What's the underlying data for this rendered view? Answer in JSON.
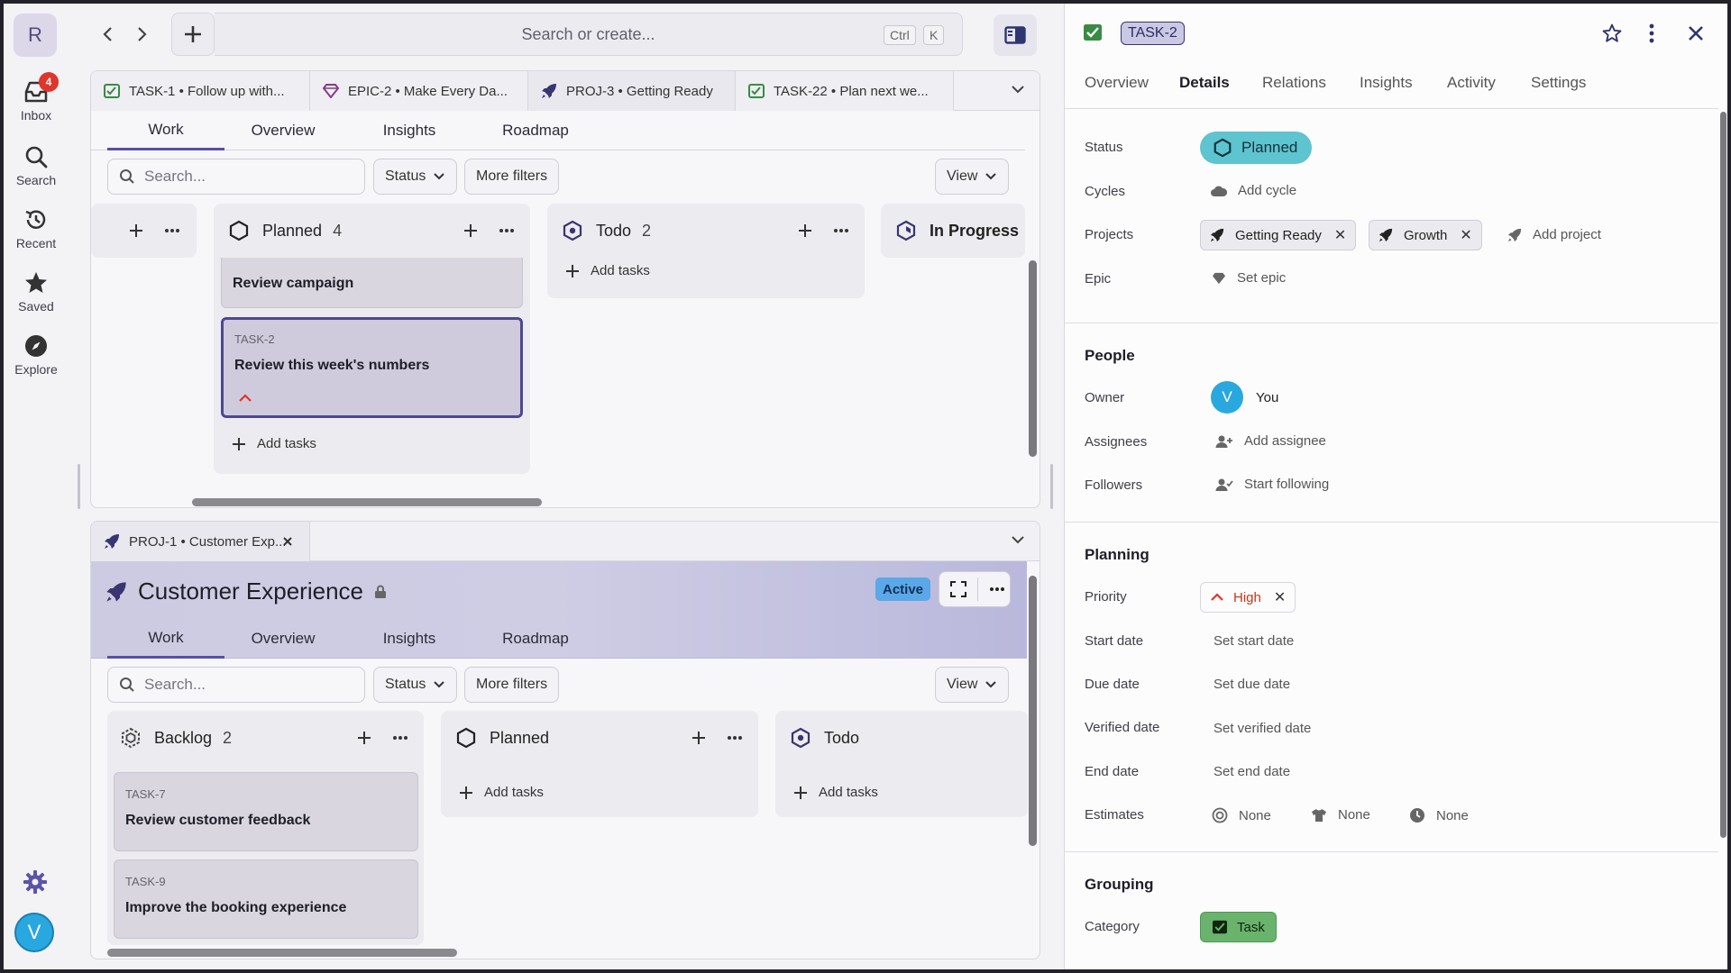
{
  "rail": {
    "workspace_initial": "R",
    "inbox_label": "Inbox",
    "inbox_badge": "4",
    "search_label": "Search",
    "recent_label": "Recent",
    "saved_label": "Saved",
    "explore_label": "Explore",
    "user_initial": "V"
  },
  "topbar": {
    "search_placeholder": "Search or create...",
    "kbd_ctrl": "Ctrl",
    "kbd_k": "K"
  },
  "top_pane": {
    "tabs": [
      {
        "label": "TASK-1 • Follow up with...",
        "icon": "task-icon"
      },
      {
        "label": "EPIC-2 • Make Every Da...",
        "icon": "epic-icon"
      },
      {
        "label": "PROJ-3 • Getting Ready",
        "icon": "rocket-icon"
      },
      {
        "label": "TASK-22 • Plan next we...",
        "icon": "task-icon"
      }
    ],
    "subtabs": [
      "Work",
      "Overview",
      "Insights",
      "Roadmap"
    ],
    "filter_search_placeholder": "Search...",
    "status_label": "Status",
    "more_filters_label": "More filters",
    "view_label": "View",
    "columns": {
      "planned": {
        "title": "Planned",
        "count": "4"
      },
      "todo": {
        "title": "Todo",
        "count": "2"
      },
      "in_progress": {
        "title": "In Progress"
      }
    },
    "cards": [
      {
        "title": "Review campaign"
      },
      {
        "key": "TASK-2",
        "title": "Review this week's numbers"
      }
    ],
    "add_tasks_label": "Add tasks"
  },
  "bottom_pane": {
    "tab_label": "PROJ-1 • Customer Exp...",
    "project_title": "Customer Experience",
    "status_badge": "Active",
    "subtabs": [
      "Work",
      "Overview",
      "Insights",
      "Roadmap"
    ],
    "filter_search_placeholder": "Search...",
    "status_label": "Status",
    "more_filters_label": "More filters",
    "view_label": "View",
    "columns": {
      "backlog": {
        "title": "Backlog",
        "count": "2"
      },
      "planned": {
        "title": "Planned"
      },
      "todo": {
        "title": "Todo"
      }
    },
    "cards": [
      {
        "key": "TASK-7",
        "title": "Review customer feedback"
      },
      {
        "key": "TASK-9",
        "title": "Improve the booking experience"
      }
    ],
    "add_tasks_label": "Add tasks"
  },
  "detail": {
    "task_key": "TASK-2",
    "tabs": [
      "Overview",
      "Details",
      "Relations",
      "Insights",
      "Activity",
      "Settings"
    ],
    "active_tab": "Details",
    "fields": {
      "status_label": "Status",
      "status_value": "Planned",
      "cycles_label": "Cycles",
      "cycles_value": "Add cycle",
      "projects_label": "Projects",
      "project_chips": [
        "Getting Ready",
        "Growth"
      ],
      "add_project": "Add project",
      "epic_label": "Epic",
      "epic_value": "Set epic"
    },
    "people": {
      "title": "People",
      "owner_label": "Owner",
      "owner_initial": "V",
      "owner_value": "You",
      "assignees_label": "Assignees",
      "assignees_value": "Add assignee",
      "followers_label": "Followers",
      "followers_value": "Start following"
    },
    "planning": {
      "title": "Planning",
      "priority_label": "Priority",
      "priority_value": "High",
      "start_label": "Start date",
      "start_value": "Set start date",
      "due_label": "Due date",
      "due_value": "Set due date",
      "verified_label": "Verified date",
      "verified_value": "Set verified date",
      "end_label": "End date",
      "end_value": "Set end date",
      "estimates_label": "Estimates",
      "estimates_values": [
        "None",
        "None",
        "None"
      ]
    },
    "grouping": {
      "title": "Grouping",
      "category_label": "Category",
      "category_value": "Task"
    }
  },
  "colors": {
    "accent": "#5750a8",
    "planned_status": "#5ec4cf",
    "task_category": "#6ab36d",
    "priority_high": "#e0352b",
    "badge_red": "#e0352b",
    "avatar_blue": "#29a8e0"
  }
}
